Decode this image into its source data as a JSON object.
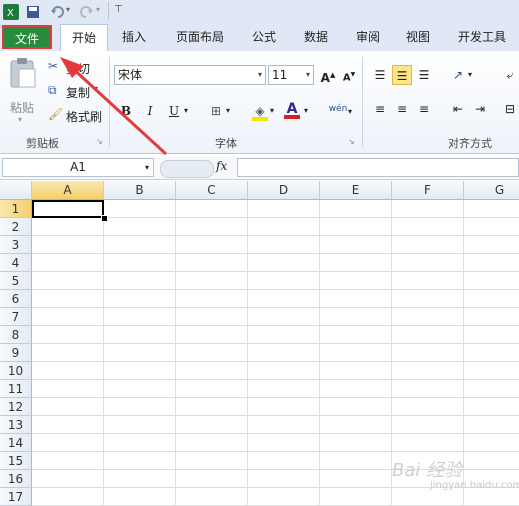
{
  "tabs": [
    {
      "label": "文件"
    },
    {
      "label": "开始"
    },
    {
      "label": "插入"
    },
    {
      "label": "页面布局"
    },
    {
      "label": "公式"
    },
    {
      "label": "数据"
    },
    {
      "label": "审阅"
    },
    {
      "label": "视图"
    },
    {
      "label": "开发工具"
    }
  ],
  "clipboard": {
    "paste": "粘贴",
    "cut": "剪切",
    "copy": "复制",
    "format_painter": "格式刷",
    "group": "剪贴板"
  },
  "font": {
    "name": "宋体",
    "size": "11",
    "group": "字体",
    "bold": "B",
    "italic": "I",
    "underline": "U",
    "font_color_letter": "A",
    "grow": "A",
    "shrink": "A",
    "wen": "wén"
  },
  "alignment": {
    "group": "对齐方式"
  },
  "formula_bar": {
    "name_box": "A1",
    "fx": "fx"
  },
  "columns": [
    "A",
    "B",
    "C",
    "D",
    "E",
    "F",
    "G"
  ],
  "rows": [
    "1",
    "2",
    "3",
    "4",
    "5",
    "6",
    "7",
    "8",
    "9",
    "10",
    "11",
    "12",
    "13",
    "14",
    "15",
    "16",
    "17"
  ],
  "watermark": {
    "brand": "Bai 经验",
    "url": "jingyan.baidu.com"
  }
}
